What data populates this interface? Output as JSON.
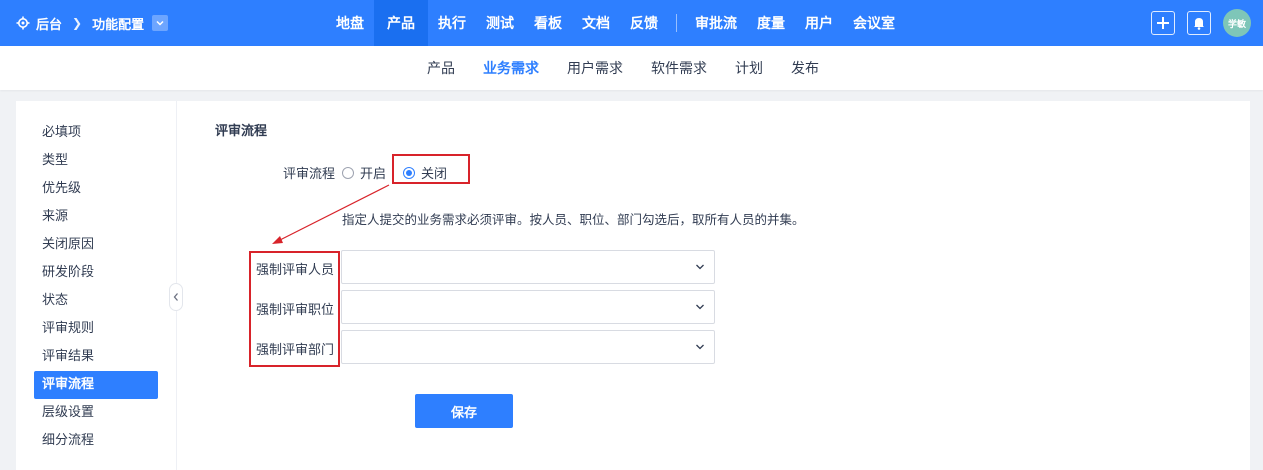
{
  "breadcrumb": {
    "root": "后台",
    "current": "功能配置"
  },
  "nav": {
    "items": [
      {
        "label": "地盘",
        "active": false
      },
      {
        "label": "产品",
        "active": true
      },
      {
        "label": "执行",
        "active": false
      },
      {
        "label": "测试",
        "active": false
      },
      {
        "label": "看板",
        "active": false
      },
      {
        "label": "文档",
        "active": false
      },
      {
        "label": "反馈",
        "active": false
      }
    ],
    "items2": [
      {
        "label": "审批流"
      },
      {
        "label": "度量"
      },
      {
        "label": "用户"
      },
      {
        "label": "会议室"
      }
    ]
  },
  "user": {
    "avatar_text": "学敏"
  },
  "subnav": [
    {
      "label": "产品",
      "active": false
    },
    {
      "label": "业务需求",
      "active": true
    },
    {
      "label": "用户需求",
      "active": false
    },
    {
      "label": "软件需求",
      "active": false
    },
    {
      "label": "计划",
      "active": false
    },
    {
      "label": "发布",
      "active": false
    }
  ],
  "sidebar": [
    {
      "label": "必填项"
    },
    {
      "label": "类型"
    },
    {
      "label": "优先级"
    },
    {
      "label": "来源"
    },
    {
      "label": "关闭原因"
    },
    {
      "label": "研发阶段"
    },
    {
      "label": "状态"
    },
    {
      "label": "评审规则"
    },
    {
      "label": "评审结果"
    },
    {
      "label": "评审流程",
      "active": true
    },
    {
      "label": "层级设置"
    },
    {
      "label": "细分流程"
    }
  ],
  "main": {
    "section_title": "评审流程",
    "review_label": "评审流程",
    "option_on": "开启",
    "option_off": "关闭",
    "selected": "关闭",
    "hint": "指定人提交的业务需求必须评审。按人员、职位、部门勾选后，取所有人员的并集。",
    "fields": [
      {
        "label": "强制评审人员",
        "value": ""
      },
      {
        "label": "强制评审职位",
        "value": ""
      },
      {
        "label": "强制评审部门",
        "value": ""
      }
    ],
    "save_label": "保存"
  },
  "colors": {
    "primary": "#2e7fff",
    "highlight": "#d8232a"
  }
}
